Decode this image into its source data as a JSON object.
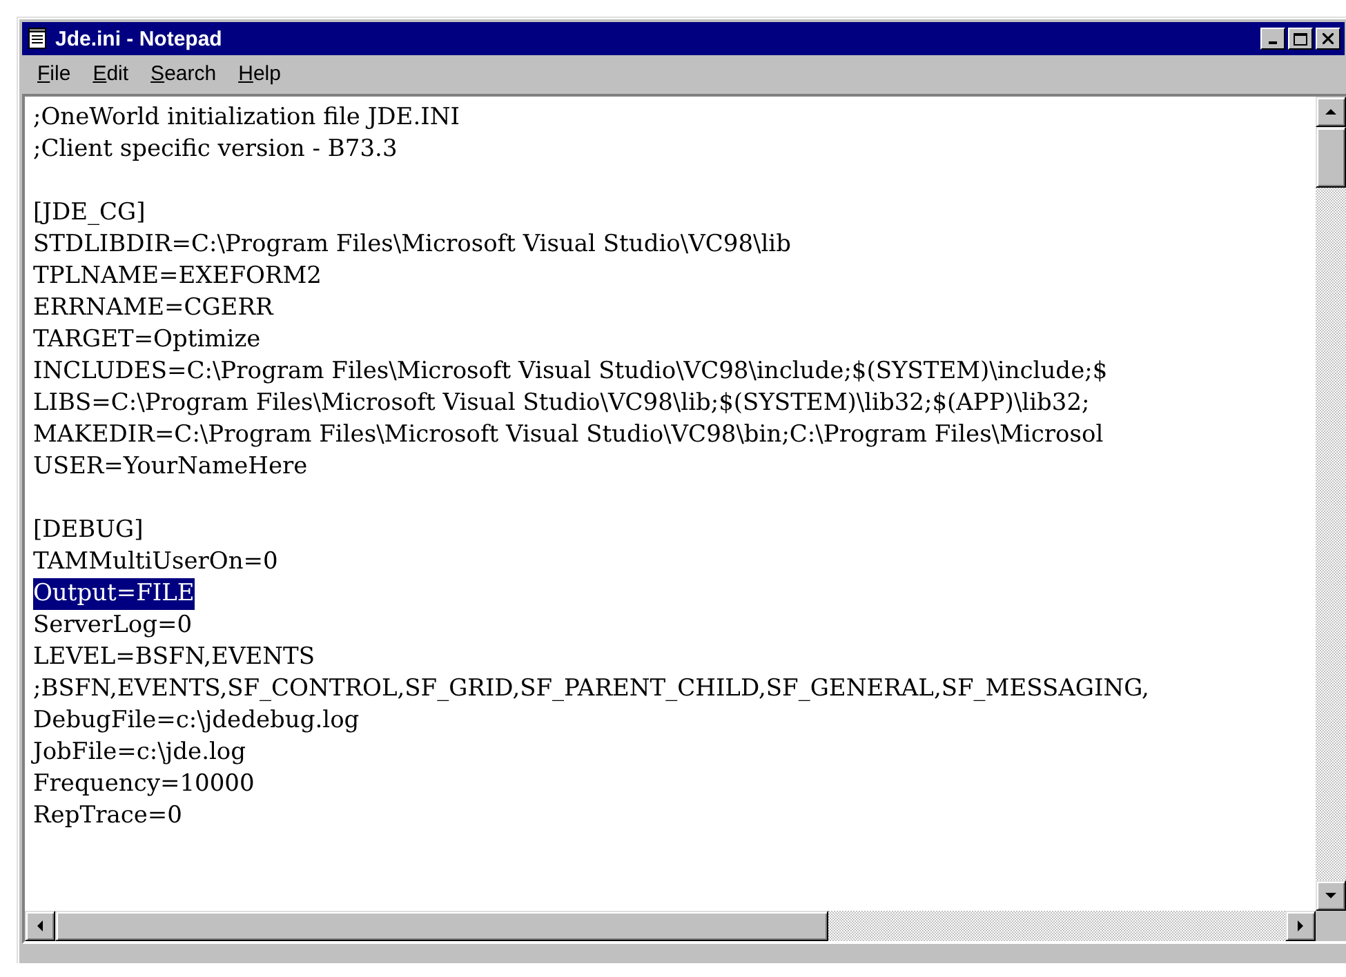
{
  "window": {
    "title": "Jde.ini - Notepad"
  },
  "menu": [
    {
      "label": "File"
    },
    {
      "label": "Edit"
    },
    {
      "label": "Search"
    },
    {
      "label": "Help"
    }
  ],
  "editor": {
    "sections": [
      {
        "lines": [
          {
            "text": ";OneWorld initialization file JDE.INI",
            "selected": false
          },
          {
            "text": ";Client specific version - B73.3",
            "selected": false
          }
        ]
      },
      {
        "lines": [
          {
            "text": "[JDE_CG]",
            "selected": false
          },
          {
            "text": "STDLIBDIR=C:\\Program Files\\Microsoft Visual Studio\\VC98\\lib",
            "selected": false
          },
          {
            "text": "TPLNAME=EXEFORM2",
            "selected": false
          },
          {
            "text": "ERRNAME=CGERR",
            "selected": false
          },
          {
            "text": "TARGET=Optimize",
            "selected": false
          },
          {
            "text": "INCLUDES=C:\\Program Files\\Microsoft Visual Studio\\VC98\\include;$(SYSTEM)\\include;$",
            "selected": false
          },
          {
            "text": "LIBS=C:\\Program Files\\Microsoft Visual Studio\\VC98\\lib;$(SYSTEM)\\lib32;$(APP)\\lib32;",
            "selected": false
          },
          {
            "text": "MAKEDIR=C:\\Program Files\\Microsoft Visual Studio\\VC98\\bin;C:\\Program Files\\Microsol",
            "selected": false
          },
          {
            "text": "USER=YourNameHere",
            "selected": false
          }
        ]
      },
      {
        "lines": [
          {
            "text": "[DEBUG]",
            "selected": false
          },
          {
            "text": "TAMMultiUserOn=0",
            "selected": false
          },
          {
            "text": "Output=FILE",
            "selected": true
          },
          {
            "text": "ServerLog=0",
            "selected": false
          },
          {
            "text": "LEVEL=BSFN,EVENTS",
            "selected": false
          },
          {
            "text": ";BSFN,EVENTS,SF_CONTROL,SF_GRID,SF_PARENT_CHILD,SF_GENERAL,SF_MESSAGING,",
            "selected": false
          },
          {
            "text": "DebugFile=c:\\jdedebug.log",
            "selected": false
          },
          {
            "text": "JobFile=c:\\jde.log",
            "selected": false
          },
          {
            "text": "Frequency=10000",
            "selected": false
          },
          {
            "text": "RepTrace=0",
            "selected": false
          }
        ]
      }
    ]
  }
}
